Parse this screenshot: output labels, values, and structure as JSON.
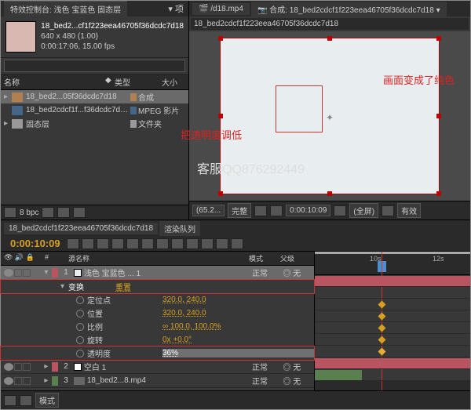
{
  "project": {
    "tab_label": "特效控制台: 浅色 宝蓝色 固态层",
    "dropdown": "项",
    "footage": {
      "name": "18_bed2...cf1f223eea46705f36dcdc7d18",
      "dims": "640 x 480 (1.00)",
      "duration": "0:00:17:06, 15.00 fps"
    },
    "search_placeholder": "",
    "columns": {
      "name": "名称",
      "type": "类型",
      "size": "大小"
    },
    "items": [
      {
        "name": "18_bed2...05f36dcdc7d18",
        "type": "合成",
        "color": "#b08050",
        "icon": "comp"
      },
      {
        "name": "18_bed2cdcf1f...f36dcdc7d18.mp4",
        "type": "MPEG 影片",
        "color": "#446688",
        "icon": "video"
      },
      {
        "name": "固态层",
        "type": "文件夹",
        "color": "#999",
        "icon": "folder"
      }
    ],
    "bpc": "8 bpc"
  },
  "viewer": {
    "tab1": "/d18.mp4",
    "tab2_prefix": "合成:",
    "tab2": "18_bed2cdcf1f223eea46705f36dcdc7d18",
    "comp_tab": "18_bed2cdcf1f223eea46705f36dcdc7d18",
    "annotation": "画面变成了纯色",
    "watermark": "客服QQ876292449",
    "toolbar": {
      "zoom": "(65.2...",
      "res": "完整",
      "time": "0:00:10:09",
      "view": "(全屏)",
      "active": "有效"
    }
  },
  "timeline": {
    "tab1": "18_bed2cdcf1f223eea46705f36dcdc7d18",
    "tab2": "渲染队列",
    "timecode": "0:00:10:09",
    "ruler": {
      "t1": "10s",
      "t2": "12s"
    },
    "columns": {
      "index": "#",
      "source": "源名称",
      "mode": "模式",
      "parent": "父级"
    },
    "layers": [
      {
        "index": "1",
        "name": "浅色 宝蓝色 ... 1",
        "swatch": "#e8eef0",
        "color": "#b85560",
        "mode": "正常",
        "parent": "无"
      },
      {
        "index": "2",
        "name": "空白 1",
        "swatch": "#fff",
        "color": "#b85560",
        "mode": "正常",
        "parent": "无"
      },
      {
        "index": "3",
        "name": "18_bed2...8.mp4",
        "swatch_img": true,
        "color": "#5a8050",
        "mode": "正常",
        "parent": "无"
      }
    ],
    "transform": {
      "group": "变换",
      "reset": "重置",
      "anchor": {
        "label": "定位点",
        "value": "320.0, 240.0"
      },
      "position": {
        "label": "位置",
        "value": "320.0, 240.0"
      },
      "scale": {
        "label": "比例",
        "value": "100.0, 100.0%"
      },
      "rotation": {
        "label": "旋转",
        "value": "0x +0.0°"
      },
      "opacity": {
        "label": "透明度",
        "value": "36%"
      }
    },
    "annotation": "把透明度调低",
    "mode_btn": "模式"
  }
}
